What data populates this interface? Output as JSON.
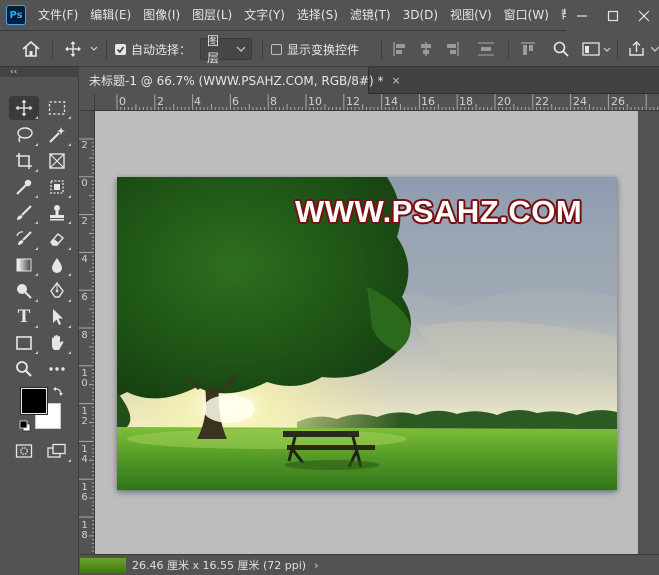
{
  "app": {
    "logo_text": "Ps",
    "menu": [
      "文件(F)",
      "编辑(E)",
      "图像(I)",
      "图层(L)",
      "文字(Y)",
      "选择(S)",
      "滤镜(T)",
      "3D(D)",
      "视图(V)",
      "窗口(W)",
      "帮"
    ],
    "window_controls": [
      "minimize-icon",
      "maximize-icon",
      "close-icon"
    ]
  },
  "options_bar": {
    "auto_select_label": "自动选择：",
    "auto_select_checked": true,
    "auto_select_target": "图层",
    "show_transform_label": "显示变换控件",
    "show_transform_checked": false
  },
  "toolbox": {
    "collapse_label": "‹‹",
    "tools": [
      {
        "name": "move-tool",
        "icon": "move-icon",
        "active": true
      },
      {
        "name": "marquee-tool",
        "icon": "rect-marquee-icon"
      },
      {
        "name": "lasso-tool",
        "icon": "lasso-icon"
      },
      {
        "name": "quick-select-tool",
        "icon": "magic-wand-icon"
      },
      {
        "name": "crop-tool",
        "icon": "crop-icon"
      },
      {
        "name": "frame-tool",
        "icon": "frame-icon"
      },
      {
        "name": "eyedropper-tool",
        "icon": "eyedropper-icon"
      },
      {
        "name": "healing-tool",
        "icon": "healing-brush-icon"
      },
      {
        "name": "brush-tool",
        "icon": "brush-icon"
      },
      {
        "name": "stamp-tool",
        "icon": "clone-stamp-icon"
      },
      {
        "name": "history-brush-tool",
        "icon": "history-brush-icon"
      },
      {
        "name": "eraser-tool",
        "icon": "eraser-icon"
      },
      {
        "name": "gradient-tool",
        "icon": "gradient-icon"
      },
      {
        "name": "blur-tool",
        "icon": "blur-drop-icon"
      },
      {
        "name": "dodge-tool",
        "icon": "dodge-icon"
      },
      {
        "name": "pen-tool",
        "icon": "pen-icon"
      },
      {
        "name": "type-tool",
        "icon": "type-icon",
        "glyph": "T"
      },
      {
        "name": "path-select-tool",
        "icon": "arrow-select-icon"
      },
      {
        "name": "shape-tool",
        "icon": "rectangle-shape-icon"
      },
      {
        "name": "hand-tool",
        "icon": "hand-icon"
      },
      {
        "name": "zoom-tool",
        "icon": "zoom-icon"
      },
      {
        "name": "more-tools",
        "icon": "more-dots-icon"
      }
    ],
    "foreground_color": "#000000",
    "background_color": "#ffffff"
  },
  "document": {
    "tab_title": "未标题-1 @ 66.7% (WWW.PSAHZ.COM, RGB/8#) *",
    "tab_close": "×",
    "watermark": "WWW.PSAHZ.COM"
  },
  "rulers": {
    "horizontal_labels": [
      "0",
      "2",
      "4",
      "6",
      "8",
      "10",
      "12",
      "14",
      "16",
      "18",
      "20",
      "22",
      "24",
      "26"
    ],
    "vertical_labels": [
      "2",
      "0",
      "2",
      "4",
      "6",
      "8",
      "10",
      "12",
      "14",
      "16",
      "18"
    ]
  },
  "status": {
    "size_text": "26.46 厘米 x 16.55 厘米 (72 ppi)",
    "arrow": "›"
  }
}
